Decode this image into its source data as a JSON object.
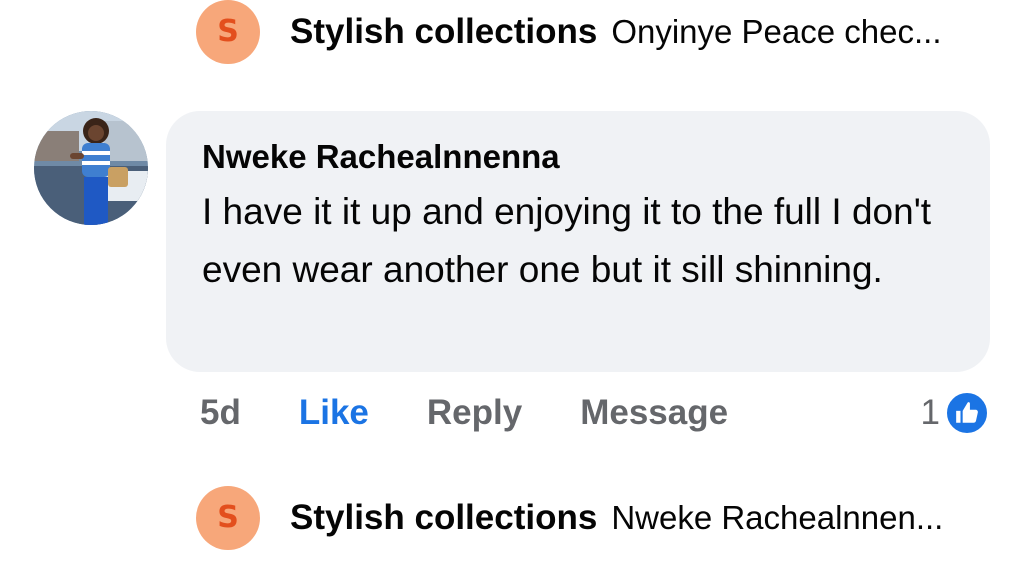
{
  "reply_top": {
    "avatar_letter": "S",
    "author": "Stylish collections",
    "snippet": "Onyinye Peace chec..."
  },
  "comment": {
    "author": "Nweke Rachealnnenna",
    "text": "I have it it up and enjoying it to the full I don't even wear another one but it sill shinning.",
    "time": "5d",
    "actions": {
      "like": "Like",
      "reply": "Reply",
      "message": "Message"
    },
    "reaction_count": "1",
    "reaction_icon": "thumbs-up-icon"
  },
  "reply_bottom": {
    "avatar_letter": "S",
    "author": "Stylish collections",
    "snippet": "Nweke Rachealnnen..."
  },
  "colors": {
    "like_blue": "#1b74e4",
    "bubble_bg": "#f0f2f5",
    "muted_text": "#65676b",
    "reply_avatar_bg": "#f7a77a",
    "reply_avatar_letter": "#e34f1d"
  }
}
